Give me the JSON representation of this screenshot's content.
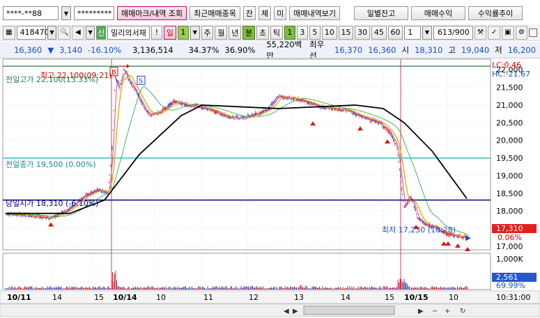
{
  "toolbar1": {
    "account": "****-**88",
    "password": "*********",
    "btn_trade_mark": "매매마크/내역 조회",
    "btn_recent_trades": "최근매매종목",
    "btn_jan": "잔",
    "btn_che": "체",
    "btn_mi": "미",
    "btn_trade_view": "매매내역보기",
    "btn_daily_balance": "일별잔고",
    "btn_trade_profit": "매매수익",
    "btn_profit_trend": "수익률추이"
  },
  "toolbar2": {
    "code": "418470",
    "badge_new": "신",
    "name": "밀리의서재",
    "exclaim": "!",
    "period_label": "일",
    "period_value": "1",
    "periods": [
      "주",
      "월",
      "년",
      "분",
      "초",
      "틱"
    ],
    "intervals": [
      "1",
      "3",
      "5",
      "10",
      "15",
      "30",
      "45",
      "60"
    ],
    "interval_value": "1",
    "count": "613",
    "count_total": "/900"
  },
  "quote": {
    "price": "16,360",
    "arrow": "▼",
    "change": "3,140",
    "change_pct": "-16.10%",
    "volume": "3,136,514",
    "ratio1": "34.37%",
    "ratio2": "36.90%",
    "amount": "55,220백만",
    "best_ask_label": "최우선",
    "best_ask": "16,370",
    "best_bid": "16,360",
    "open_label": "시",
    "open": "18,310",
    "high_label": "고",
    "high": "19,040",
    "low_label": "저",
    "low": "16,200"
  },
  "chart_data": {
    "type": "candlestick",
    "annotations": {
      "high": "최고 22,100(09:21)",
      "prev_high": "전일고가 22,100(13.33%)",
      "prev_close": "전일종가 19,500 (0.00%)",
      "open_today": "당일시가 18,310 (-6,10%)",
      "low": "최저 17,230 (10:28)",
      "lc": "LC:0.46",
      "hc": "HC:-21.67"
    },
    "price_ticks": [
      "22,000",
      "21,500",
      "21,000",
      "20,500",
      "20,000",
      "19,500",
      "19,000",
      "18,500",
      "18,000",
      "17,500",
      "17,000"
    ],
    "current_price_tag": "17,310",
    "current_pct_tag": "0.06%",
    "volume_tick": "1,000K",
    "volume_tag": "2,561",
    "volume_pct_tag": "69.99%",
    "time_ticks": [
      "10/11",
      "14",
      "15",
      "10/14",
      "10",
      "11",
      "12",
      "13",
      "14",
      "15",
      "10/15",
      "10"
    ],
    "time_readout": "10:31:00",
    "ylim": [
      16900,
      22300
    ],
    "lines": {
      "prev_high": 22100,
      "prev_close": 19500,
      "open_today": 18310
    }
  }
}
